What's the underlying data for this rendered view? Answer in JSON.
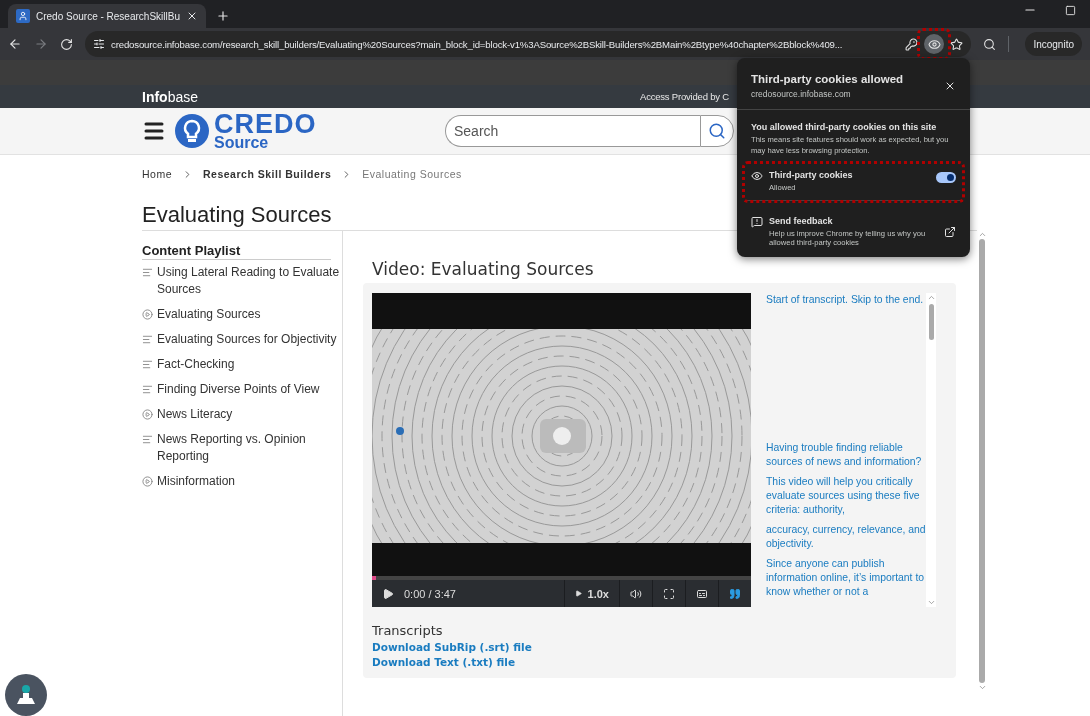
{
  "browser": {
    "tab": {
      "title": "Credo Source - ResearchSkillBu",
      "selected": true
    },
    "address": "credosource.infobase.com/research_skill_builders/Evaluating%20Sources?main_block_id=block-v1%3ASource%2BSkill-Builders%2BMain%2Btype%40chapter%2Bblock%409...",
    "forward_disabled": true,
    "profile": "Incognito"
  },
  "cookie_popup": {
    "title": "Third-party cookies allowed",
    "site": "credosource.infobase.com",
    "heading": "You allowed third-party cookies on this site",
    "body": "This means site features should work as expected, but you may have less browsing protection.",
    "toggle": {
      "label": "Third-party cookies",
      "status": "Allowed",
      "on": true
    },
    "feedback": {
      "label": "Send feedback",
      "description": "Help us improve Chrome by telling us why you allowed third-party cookies"
    }
  },
  "top_bar": {
    "brand_bold": "Info",
    "brand_light": "base",
    "access": "Access Provided by C"
  },
  "header": {
    "logo_main": "CREDO",
    "logo_sub": "Source",
    "search": {
      "placeholder": "Search"
    }
  },
  "breadcrumb": [
    {
      "label": "Home",
      "kind": "link"
    },
    {
      "label": "Research Skill Builders",
      "kind": "strong"
    },
    {
      "label": "Evaluating Sources",
      "kind": "current"
    }
  ],
  "page_title": "Evaluating Sources",
  "playlist": {
    "title": "Content Playlist",
    "items": [
      {
        "label": "Using Lateral Reading to Evaluate Sources",
        "kind": "text"
      },
      {
        "label": "Evaluating Sources",
        "kind": "video"
      },
      {
        "label": "Evaluating Sources for Objectivity",
        "kind": "text"
      },
      {
        "label": "Fact-Checking",
        "kind": "text"
      },
      {
        "label": "Finding Diverse Points of View",
        "kind": "text"
      },
      {
        "label": "News Literacy",
        "kind": "video"
      },
      {
        "label": "News Reporting vs. Opinion Reporting",
        "kind": "text"
      },
      {
        "label": "Misinformation",
        "kind": "video"
      }
    ]
  },
  "video": {
    "title": "Video: Evaluating Sources",
    "time": "0:00 / 3:47",
    "speed": "1.0x",
    "transcript_on": true,
    "transcript": [
      "Start of transcript. Skip to the end.",
      "Having trouble finding reliable sources of news and information?",
      "This video will help you critically evaluate sources using these five criteria: authority,",
      "accuracy, currency, relevance, and objectivity.",
      "Since anyone can publish information online, it’s important to know whether or not a"
    ]
  },
  "transcripts": {
    "title": "Transcripts",
    "links": [
      "Download SubRip (.srt) file",
      "Download Text (.txt) file"
    ]
  }
}
